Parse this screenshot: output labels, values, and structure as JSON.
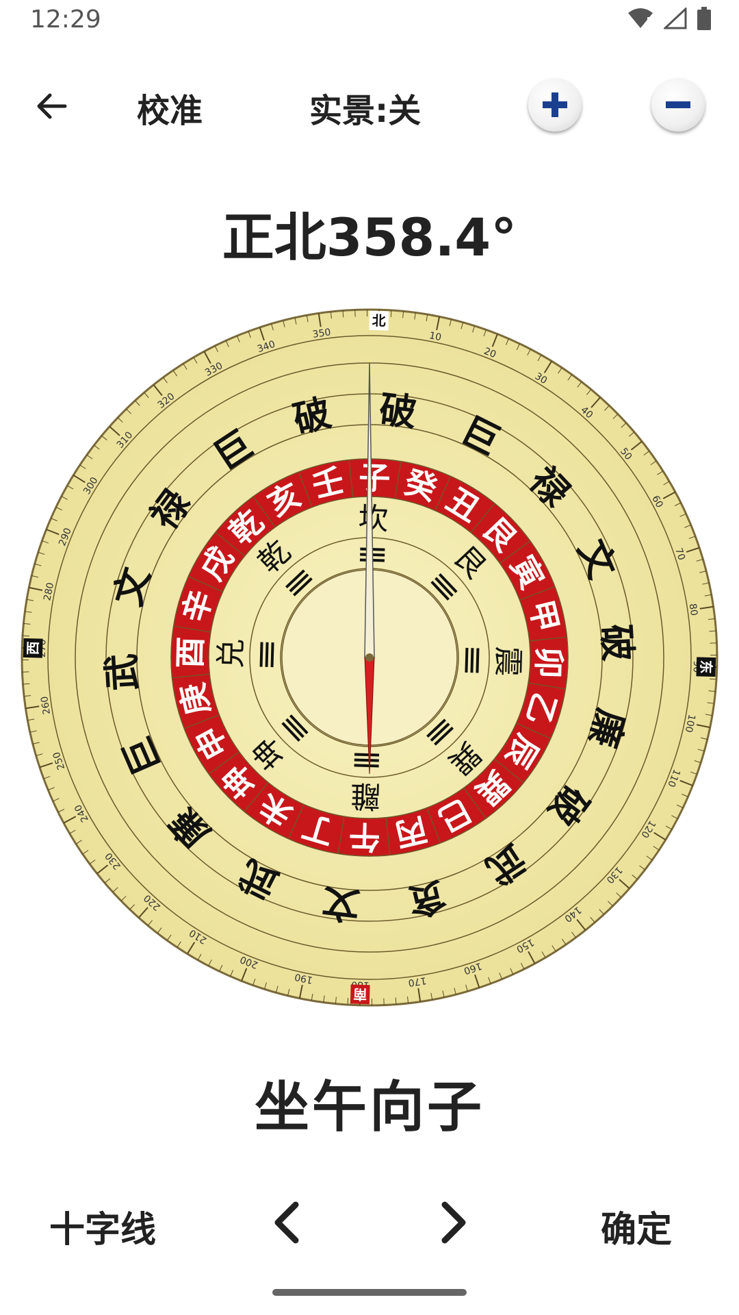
{
  "status": {
    "time": "12:29"
  },
  "toolbar": {
    "calibrate": "校准",
    "real_view": "实景:关"
  },
  "heading": "正北358.4°",
  "compass": {
    "heading_degrees": 358.4,
    "cardinals": {
      "north": "北",
      "east": "东",
      "south": "南",
      "west": "西"
    },
    "degree_labels": [
      "10",
      "20",
      "30",
      "40",
      "50",
      "60",
      "70",
      "80",
      "90",
      "100",
      "110",
      "120",
      "130",
      "140",
      "150",
      "160",
      "170",
      "180",
      "190",
      "200",
      "210",
      "220",
      "230",
      "240",
      "250",
      "260",
      "270",
      "280",
      "290",
      "300",
      "310",
      "320",
      "330",
      "340",
      "350"
    ],
    "bagua": [
      "坎",
      "艮",
      "震",
      "巽",
      "離",
      "坤",
      "兑",
      "乾"
    ],
    "mountains": [
      "壬",
      "子",
      "癸",
      "丑",
      "艮",
      "寅",
      "甲",
      "卯",
      "乙",
      "辰",
      "巽",
      "巳",
      "丙",
      "午",
      "丁",
      "未",
      "坤",
      "申",
      "庚",
      "酉",
      "辛",
      "戌",
      "乾",
      "亥"
    ],
    "stars": [
      "破",
      "巨",
      "禄",
      "文",
      "破",
      "廉",
      "破",
      "武",
      "贪",
      "文",
      "武",
      "廉",
      "巨",
      "武",
      "文",
      "禄",
      "巨",
      "破"
    ]
  },
  "direction": "坐午向子",
  "bottom": {
    "crosshair": "十字线",
    "confirm": "确定"
  },
  "colors": {
    "compass_bg": "#f3ecae",
    "ring_red": "#c8171b",
    "needle_red": "#d61f1f",
    "zoom_icon": "#1b3f8f"
  }
}
